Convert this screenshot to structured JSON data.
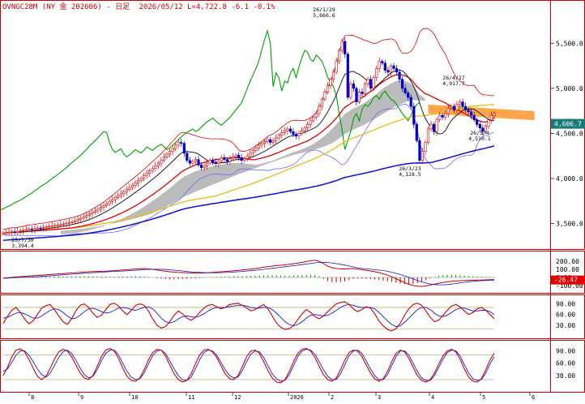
{
  "header": {
    "symbol": "OVNGC28M",
    "name": "(NY 金 202606)",
    "interval": "- 日足",
    "date": "2026/05/12",
    "last": "L=4,722.8",
    "change": "-6.1",
    "pct": "-0.1%"
  },
  "colors": {
    "candle_up": "#e00000",
    "candle_down": "#0000cc",
    "sma_short": "#222222",
    "sma_mid": "#e00000",
    "sma_long": "#e8c020",
    "sma_xlong": "#1a1acc",
    "chikou": "#00a000",
    "bollinger": "#6a6aff",
    "envelope": "#e00000",
    "cloud_gray": "#b4b4b4",
    "cloud_orange": "#ffa040",
    "price_tag": "#1a7a7a",
    "macd_tag": "#e00000",
    "panel_border": "#cc0000",
    "ref_line": "#b8b870"
  },
  "annotations": [
    {
      "date": "26/1/29",
      "value": "5,666.6"
    },
    {
      "date": "25/7/30",
      "value": "3,394.4"
    },
    {
      "date": "26/3/23",
      "value": "4,128.5"
    },
    {
      "date": "26/4/17",
      "value": "4,917.7"
    },
    {
      "date": "26/5/4",
      "value": "4,510.1"
    }
  ],
  "price_tag": "4,606.7",
  "macd_tag": "-26.47",
  "chart_data": [
    {
      "type": "candlestick",
      "title": "OVNGC28M (NY 金 202606) - 日足",
      "x_tick_labels": [
        "8",
        "9",
        "10",
        "11",
        "12",
        "2026",
        "2",
        "3",
        "4",
        "5",
        "6"
      ],
      "y_tick_labels": [
        "5,500.0",
        "5,000.0",
        "4,500.0",
        "4,000.0",
        "3,500.0"
      ],
      "ylim": [
        3280,
        5800
      ],
      "grid": false,
      "cloud_shading": "gray before April 2026, orange from April 2026 projecting forward",
      "close_series": [
        3394,
        3398,
        3405,
        3410,
        3400,
        3415,
        3420,
        3428,
        3435,
        3440,
        3432,
        3445,
        3450,
        3448,
        3455,
        3462,
        3470,
        3475,
        3480,
        3485,
        3492,
        3498,
        3505,
        3512,
        3520,
        3530,
        3545,
        3560,
        3575,
        3590,
        3610,
        3625,
        3640,
        3660,
        3680,
        3700,
        3720,
        3745,
        3765,
        3790,
        3810,
        3830,
        3855,
        3880,
        3900,
        3925,
        3950,
        3975,
        4000,
        4030,
        4060,
        4085,
        4110,
        4140,
        4170,
        4200,
        4240,
        4270,
        4300,
        4330,
        4370,
        4400,
        4390,
        4280,
        4200,
        4170,
        4190,
        4210,
        4150,
        4120,
        4140,
        4170,
        4200,
        4180,
        4165,
        4190,
        4230,
        4210,
        4190,
        4220,
        4240,
        4260,
        4230,
        4200,
        4220,
        4250,
        4280,
        4310,
        4340,
        4370,
        4390,
        4410,
        4430,
        4400,
        4420,
        4450,
        4480,
        4510,
        4530,
        4550,
        4520,
        4490,
        4470,
        4500,
        4530,
        4560,
        4600,
        4640,
        4680,
        4720,
        4800,
        4880,
        4960,
        5030,
        5100,
        5180,
        5300,
        5420,
        5520,
        5380,
        4900,
        5050,
        5000,
        4850,
        4960,
        4940,
        5050,
        5100,
        5000,
        5120,
        5220,
        5300,
        5280,
        5200,
        5180,
        5250,
        5220,
        5180,
        5100,
        5000,
        4950,
        4900,
        4800,
        4600,
        4420,
        4200,
        4300,
        4400,
        4550,
        4600,
        4520,
        4650,
        4700,
        4680,
        4720,
        4780,
        4800,
        4760,
        4820,
        4850,
        4800,
        4760,
        4740,
        4700,
        4650,
        4600,
        4560,
        4520,
        4580,
        4650,
        4700,
        4722
      ],
      "high_points": [
        {
          "x": "26/1/29",
          "y": 5666.6
        },
        {
          "x": "26/4/17",
          "y": 4917.7
        }
      ],
      "low_points": [
        {
          "x": "25/7/30",
          "y": 3394.4
        },
        {
          "x": "26/3/23",
          "y": 4128.5
        },
        {
          "x": "26/5/4",
          "y": 4510.1
        }
      ],
      "last_value": 4606.7
    },
    {
      "type": "line",
      "title": "MACD",
      "y_tick_labels": [
        "200.00",
        "100.00",
        "0.00",
        "-100.00"
      ],
      "ylim": [
        -140,
        260
      ],
      "values": [
        -10,
        -5,
        0,
        6,
        10,
        14,
        18,
        22,
        25,
        28,
        32,
        36,
        40,
        44,
        48,
        52,
        55,
        58,
        62,
        66,
        70,
        72,
        74,
        76,
        78,
        80,
        84,
        88,
        92,
        96,
        100,
        104,
        108,
        110,
        106,
        100,
        92,
        84,
        76,
        70,
        66,
        62,
        60,
        58,
        56,
        54,
        54,
        56,
        58,
        62,
        66,
        70,
        74,
        78,
        82,
        86,
        92,
        98,
        104,
        110,
        118,
        126,
        134,
        140,
        146,
        150,
        156,
        162,
        170,
        178,
        186,
        196,
        206,
        212,
        200,
        170,
        140,
        120,
        110,
        106,
        104,
        108,
        110,
        104,
        96,
        88,
        80,
        70,
        60,
        45,
        28,
        8,
        -15,
        -40,
        -65,
        -85,
        -100,
        -108,
        -110,
        -104,
        -94,
        -84,
        -72,
        -62,
        -54,
        -48,
        -44,
        -40,
        -38,
        -36,
        -34,
        -32,
        -32,
        -30,
        -28,
        -26
      ],
      "last_value": -26.47
    },
    {
      "type": "line",
      "title": "Oscillator",
      "y_tick_labels": [
        "90.00",
        "60.00",
        "30.00"
      ],
      "ylim": [
        0,
        105
      ],
      "reference_lines": [
        80,
        20
      ],
      "values": [
        35,
        55,
        72,
        80,
        66,
        48,
        34,
        42,
        60,
        78,
        85,
        88,
        74,
        56,
        40,
        32,
        48,
        70,
        86,
        90,
        80,
        64,
        52,
        58,
        74,
        88,
        92,
        84,
        70,
        60,
        72,
        86,
        90,
        86,
        70,
        48,
        30,
        22,
        26,
        40,
        58,
        70,
        62,
        50,
        44,
        52,
        66,
        78,
        86,
        88,
        82,
        76,
        80,
        88,
        90,
        92,
        86,
        78,
        70,
        74,
        82,
        88,
        76,
        56,
        36,
        24,
        18,
        20,
        30,
        46,
        62,
        74,
        66,
        54,
        48,
        56,
        68,
        80,
        90,
        94,
        96,
        88,
        76,
        68,
        74,
        82,
        78,
        62,
        42,
        28,
        18,
        14,
        20,
        36,
        58,
        76,
        88,
        92,
        86,
        70,
        52,
        40,
        44,
        58,
        72,
        84,
        88,
        82,
        70,
        60,
        66,
        76,
        80,
        72,
        60,
        48
      ],
      "signal": [
        50,
        52,
        58,
        64,
        66,
        62,
        56,
        50,
        50,
        56,
        64,
        72,
        76,
        74,
        66,
        56,
        48,
        50,
        58,
        68,
        76,
        78,
        74,
        68,
        64,
        66,
        72,
        78,
        80,
        78,
        74,
        72,
        76,
        80,
        82,
        76,
        64,
        50,
        40,
        36,
        40,
        48,
        54,
        56,
        54,
        52,
        56,
        62,
        70,
        76,
        80,
        80,
        80,
        82,
        84,
        86,
        86,
        84,
        80,
        78,
        78,
        80,
        80,
        74,
        64,
        52,
        40,
        32,
        28,
        32,
        40,
        50,
        58,
        60,
        58,
        56,
        58,
        64,
        72,
        80,
        86,
        88,
        86,
        82,
        80,
        80,
        80,
        76,
        66,
        54,
        42,
        32,
        26,
        28,
        38,
        50,
        62,
        74,
        80,
        80,
        74,
        64,
        56,
        54,
        58,
        66,
        74,
        78,
        78,
        74,
        70,
        70,
        72,
        72,
        68,
        60
      ]
    },
    {
      "type": "line",
      "title": "Stochastics",
      "y_tick_labels": [
        "90.00",
        "60.00",
        "30.00"
      ],
      "ylim": [
        0,
        105
      ],
      "reference_lines": [
        80,
        20
      ],
      "values": [
        30,
        50,
        75,
        92,
        95,
        88,
        70,
        48,
        28,
        20,
        28,
        48,
        70,
        88,
        94,
        90,
        76,
        56,
        36,
        24,
        20,
        30,
        52,
        76,
        92,
        96,
        90,
        72,
        48,
        28,
        18,
        16,
        24,
        44,
        68,
        86,
        94,
        92,
        78,
        56,
        34,
        20,
        14,
        18,
        34,
        58,
        80,
        92,
        94,
        88,
        74,
        54,
        34,
        22,
        20,
        30,
        52,
        76,
        90,
        92,
        84,
        64,
        42,
        24,
        14,
        12,
        20,
        40,
        64,
        84,
        94,
        96,
        90,
        74,
        52,
        32,
        20,
        16,
        24,
        44,
        68,
        86,
        92,
        90,
        76,
        56,
        36,
        22,
        16,
        22,
        40,
        64,
        84,
        92,
        88,
        72,
        50,
        30,
        18,
        14,
        20,
        36,
        58,
        78,
        90,
        94,
        88,
        70,
        46,
        26,
        16,
        14,
        22,
        44,
        68,
        84
      ],
      "signal": [
        40,
        46,
        62,
        80,
        90,
        90,
        80,
        64,
        46,
        32,
        26,
        36,
        54,
        74,
        88,
        92,
        84,
        68,
        48,
        32,
        24,
        28,
        44,
        66,
        84,
        92,
        92,
        80,
        60,
        40,
        26,
        20,
        22,
        36,
        58,
        78,
        90,
        92,
        84,
        66,
        46,
        30,
        20,
        18,
        26,
        46,
        68,
        86,
        92,
        90,
        80,
        62,
        44,
        30,
        24,
        26,
        42,
        64,
        82,
        90,
        88,
        74,
        54,
        34,
        22,
        16,
        18,
        32,
        54,
        76,
        90,
        94,
        92,
        82,
        64,
        44,
        28,
        20,
        20,
        34,
        56,
        78,
        90,
        92,
        84,
        66,
        46,
        30,
        20,
        20,
        32,
        54,
        76,
        90,
        90,
        80,
        60,
        40,
        24,
        18,
        18,
        30,
        50,
        70,
        86,
        92,
        90,
        78,
        56,
        36,
        22,
        18,
        20,
        36,
        58,
        76
      ]
    }
  ]
}
